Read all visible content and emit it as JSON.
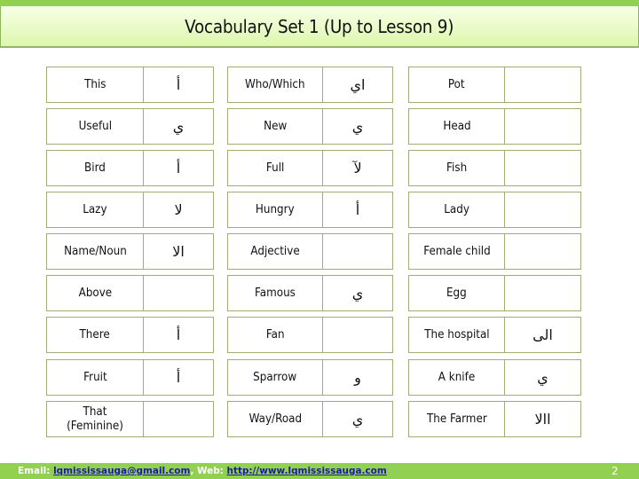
{
  "title": "Vocabulary Set 1 (Up to Lesson 9)",
  "colors": {
    "accent_green": "#92d050",
    "title_gradient_top": "#f7ffe6",
    "title_gradient_bottom": "#dcf7ad",
    "cell_border": "#a6a97a",
    "link_blue": "#1a1aa6"
  },
  "tables": [
    {
      "rows": [
        {
          "english": "This",
          "arabic": "أ"
        },
        {
          "english": "Useful",
          "arabic": "ي"
        },
        {
          "english": "Bird",
          "arabic": "أ"
        },
        {
          "english": "Lazy",
          "arabic": "لا"
        },
        {
          "english": "Name/Noun",
          "arabic": "الا"
        },
        {
          "english": "Above",
          "arabic": ""
        },
        {
          "english": "There",
          "arabic": "أ"
        },
        {
          "english": "Fruit",
          "arabic": "أ"
        },
        {
          "english": "That (Feminine)",
          "arabic": ""
        }
      ]
    },
    {
      "rows": [
        {
          "english": "Who/Which",
          "arabic": "اي"
        },
        {
          "english": "New",
          "arabic": "ي"
        },
        {
          "english": "Full",
          "arabic": "لآ"
        },
        {
          "english": "Hungry",
          "arabic": "أ"
        },
        {
          "english": "Adjective",
          "arabic": ""
        },
        {
          "english": "Famous",
          "arabic": "ي"
        },
        {
          "english": "Fan",
          "arabic": ""
        },
        {
          "english": "Sparrow",
          "arabic": "و"
        },
        {
          "english": "Way/Road",
          "arabic": "ي"
        }
      ]
    },
    {
      "rows": [
        {
          "english": "Pot",
          "arabic": ""
        },
        {
          "english": "Head",
          "arabic": ""
        },
        {
          "english": "Fish",
          "arabic": ""
        },
        {
          "english": "Lady",
          "arabic": ""
        },
        {
          "english": "Female child",
          "arabic": ""
        },
        {
          "english": "Egg",
          "arabic": ""
        },
        {
          "english": "The hospital",
          "arabic": "الى"
        },
        {
          "english": "A knife",
          "arabic": "ي"
        },
        {
          "english": "The Farmer",
          "arabic": "االا"
        }
      ]
    }
  ],
  "footer": {
    "email_label": "Email: ",
    "email": "lqmississauga@gmail.com",
    "separator": ", ",
    "web_label": "Web: ",
    "web": "http://www.lqmississauga.com",
    "page_number": "2"
  }
}
